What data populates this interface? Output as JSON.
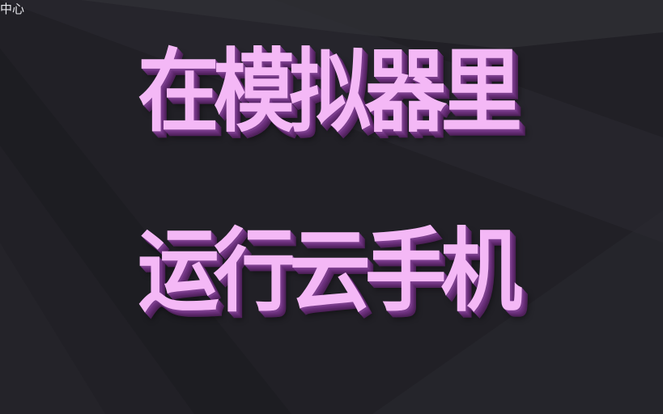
{
  "corner_label": "中心",
  "title": {
    "line1": "在模拟器里",
    "line2": "运行云手机"
  },
  "colors": {
    "background": "#232228",
    "title_fill": "#f4b8f6",
    "title_shadow": "#6a2f7a",
    "label": "#e9e9ee"
  }
}
